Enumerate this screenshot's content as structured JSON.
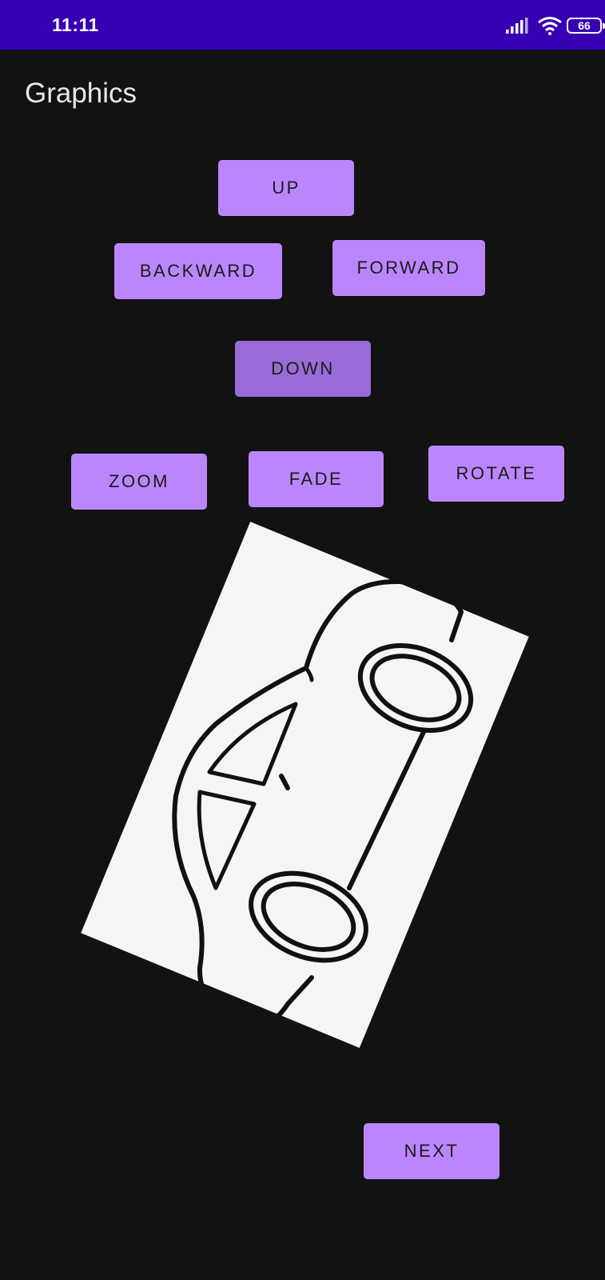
{
  "status_bar": {
    "time": "11:11",
    "battery_level": "66",
    "icons": [
      "signal-icon",
      "wifi-icon",
      "battery-icon"
    ]
  },
  "app_title": "Graphics",
  "buttons": {
    "up": "UP",
    "backward": "BACKWARD",
    "forward": "FORWARD",
    "down": "DOWN",
    "zoom": "ZOOM",
    "fade": "FADE",
    "rotate": "ROTATE",
    "next": "NEXT"
  },
  "image": {
    "subject": "car-outline-icon",
    "rotation_deg": 22.4
  },
  "colors": {
    "status_bar": "#3700B3",
    "background": "#121212",
    "button": "#BB86FC",
    "button_pressed": "#9A6BD6"
  }
}
